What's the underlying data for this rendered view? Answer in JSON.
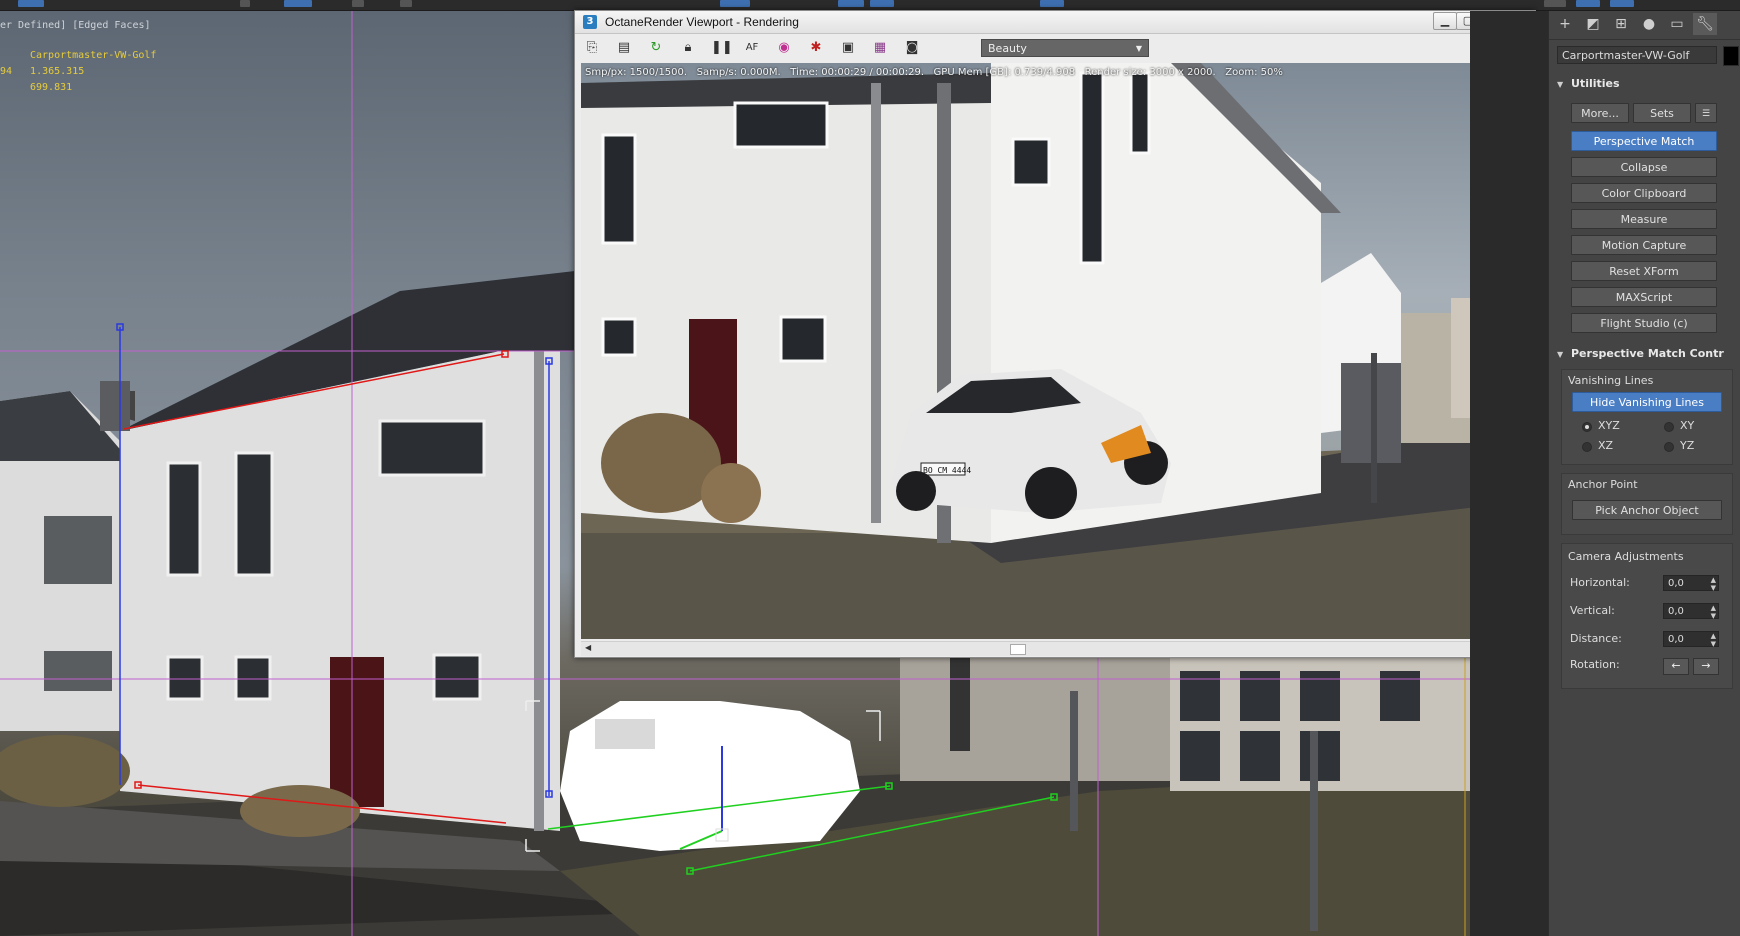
{
  "viewport": {
    "label": "er Defined] [Edged Faces]",
    "object_name": "Carportmaster-VW-Golf",
    "value_1": "1.365.315",
    "value_1_prefix": "94",
    "value_2": "699.831"
  },
  "octane": {
    "app_icon": "3",
    "title": "OctaneRender Viewport - Rendering",
    "minimize_icon": "minimize-icon",
    "maximize_icon": "maximize-icon",
    "close_icon": "close-icon",
    "channel": "Beauty",
    "stats": "Smp/px: 1500/1500.   Samp/s: 0.000M.   Time: 00:00:29 / 00:00:29.   GPU Mem [GB]: 0.739/4.908   Render size: 3000 x 2000.   Zoom: 50%",
    "toolbar_icons": [
      "copy-to-clipboard-icon",
      "save-image-icon",
      "restart-render-icon",
      "lock-icon",
      "pause-icon",
      "focus-picker-icon",
      "color-picker-icon",
      "region-render-icon",
      "film-settings-icon",
      "clay-mode-icon",
      "camera-icon"
    ],
    "license_plate": "BO CM 4444"
  },
  "panel": {
    "object_name": "Carportmaster-VW-Golf",
    "utilities": {
      "title": "Utilities",
      "more_label": "More...",
      "sets_label": "Sets",
      "buttons": [
        "Perspective Match",
        "Collapse",
        "Color Clipboard",
        "Measure",
        "Motion Capture",
        "Reset XForm",
        "MAXScript",
        "Flight Studio (c)"
      ],
      "active_button": "Perspective Match"
    },
    "perspective_match": {
      "title": "Perspective Match Contr",
      "vanishing_lines": {
        "label": "Vanishing Lines",
        "hide_button": "Hide Vanishing Lines",
        "options": [
          "XYZ",
          "XY",
          "XZ",
          "YZ"
        ],
        "selected": "XYZ"
      },
      "anchor_point": {
        "label": "Anchor Point",
        "pick_button": "Pick Anchor Object"
      },
      "camera_adjustments": {
        "label": "Camera Adjustments",
        "horizontal_label": "Horizontal:",
        "horizontal_value": "0,0",
        "vertical_label": "Vertical:",
        "vertical_value": "0,0",
        "distance_label": "Distance:",
        "distance_value": "0,0",
        "rotation_label": "Rotation:"
      }
    }
  },
  "colors": {
    "accent_blue": "#4a7ec4",
    "vanishing_red": "#e01818",
    "vanishing_green": "#20d020",
    "vanishing_blue": "#2a3ae0",
    "guide_magenta": "#c060d0",
    "viewport_label_yellow": "#e6cc3a"
  }
}
